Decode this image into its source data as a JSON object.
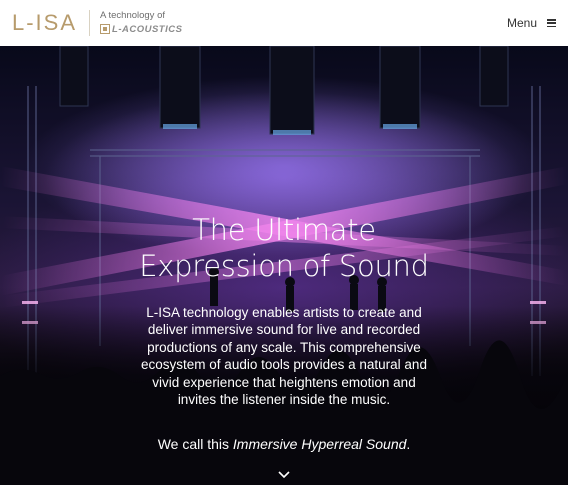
{
  "header": {
    "logo": "L-ISA",
    "tech_caption": "A technology of",
    "brand": "L-ACOUSTICS",
    "menu_label": "Menu"
  },
  "hero": {
    "title_line1": "The Ultimate",
    "title_line2": "Expression of Sound",
    "description": "L-ISA technology enables artists to create and deliver immersive sound for live and recorded productions of any scale. This comprehensive ecosystem of audio tools provides a natural and vivid experience that heightens emotion and invites the listener inside the music.",
    "tagline_prefix": "We call this ",
    "tagline_emphasis": "Immersive Hyperreal Sound",
    "tagline_suffix": "."
  },
  "icons": {
    "menu": "hamburger-icon",
    "scroll": "chevron-down-icon",
    "brand_mark": "l-acoustics-mark-icon"
  },
  "colors": {
    "logo_gold": "#b79b6c",
    "hero_purple": "#b07cff",
    "header_bg": "#ffffff"
  }
}
